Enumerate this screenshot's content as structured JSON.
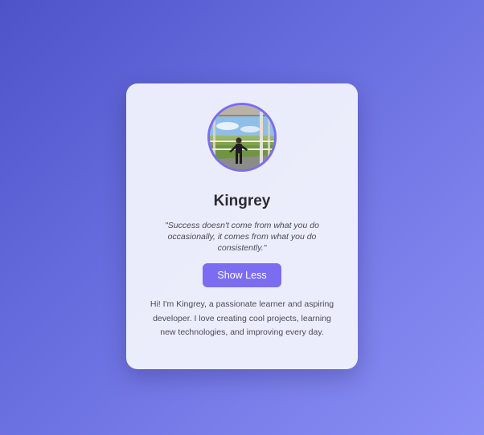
{
  "profile": {
    "name": "Kingrey",
    "quote": "\"Success doesn't come from what you do occasionally, it comes from what you do consistently.\"",
    "toggle_label": "Show Less",
    "bio": "Hi! I'm Kingrey, a passionate learner and aspiring developer. I love creating cool projects, learning new technologies, and improving every day."
  },
  "colors": {
    "accent": "#7b6cf2",
    "background_start": "#4e54c8",
    "background_end": "#8a8ff5",
    "card": "#f0f1fc"
  }
}
